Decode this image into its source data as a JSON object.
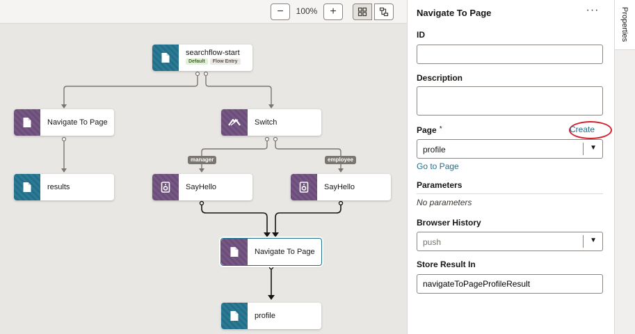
{
  "toolbar": {
    "zoom_out": "−",
    "zoom_level": "100%",
    "zoom_in": "+"
  },
  "flow": {
    "start_node": {
      "label": "searchflow-start",
      "badges": [
        "Default",
        "Flow Entry"
      ]
    },
    "nodes": {
      "navigate_left": "Navigate To Page",
      "switch": "Switch",
      "results": "results",
      "sayhello_1": "SayHello",
      "sayhello_2": "SayHello",
      "navigate_center": "Navigate To Page",
      "profile": "profile"
    },
    "case_labels": {
      "manager": "manager",
      "employee": "employee"
    }
  },
  "panel": {
    "title": "Navigate To Page",
    "more_label": "···",
    "id_label": "ID",
    "id_value": "",
    "description_label": "Description",
    "description_value": "",
    "page_label": "Page",
    "page_required": "*",
    "create_link": "Create",
    "page_value": "profile",
    "goto_link": "Go to Page",
    "parameters_label": "Parameters",
    "parameters_empty": "No parameters",
    "browser_history_label": "Browser History",
    "browser_history_placeholder": "push",
    "store_result_label": "Store Result In",
    "store_result_value": "navigateToPageProfileResult"
  },
  "side_tab": {
    "label": "Properties"
  },
  "colors": {
    "teal": "#1f6f8b",
    "purple": "#6b4c7a",
    "highlight_ring": "#d6202c"
  }
}
